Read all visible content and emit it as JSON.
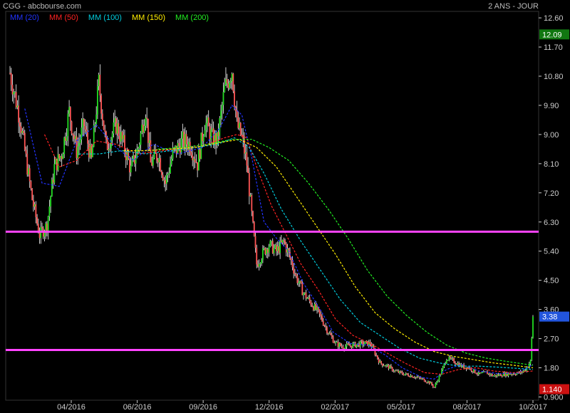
{
  "header": {
    "title": "CGG - abcbourse.com",
    "period": "2 ANS - JOUR"
  },
  "colors": {
    "up": "#22dd22",
    "down": "#ff5555",
    "wick": "#ffffff",
    "hline": "#ff44ff",
    "axis": "#cccccc",
    "last_label_bg": "#117711",
    "current_label_bg": "#2255dd",
    "low_label_bg": "#cc1111"
  },
  "chart_data": {
    "type": "candlestick",
    "ylim": [
      0.8,
      12.8
    ],
    "y_ticks": [
      "12.60",
      "11.70",
      "10.80",
      "9.90",
      "9.00",
      "8.10",
      "7.20",
      "6.30",
      "5.40",
      "4.50",
      "3.60",
      "2.70",
      "1.80",
      "0.900"
    ],
    "x_ticks": [
      "04/2016",
      "06/2016",
      "09/2016",
      "12/2016",
      "02/2017",
      "05/2017",
      "08/2017",
      "10/2017"
    ],
    "horizontal_lines": [
      6.0,
      2.35
    ],
    "price_labels": [
      {
        "value": 12.09,
        "text": "12.09",
        "kind": "last"
      },
      {
        "value": 3.38,
        "text": "3.38",
        "kind": "current"
      },
      {
        "value": 1.14,
        "text": "1.140",
        "kind": "low"
      }
    ],
    "close_path": [
      [
        0,
        10.9
      ],
      [
        8,
        9.5
      ],
      [
        18,
        7.0
      ],
      [
        24,
        5.9
      ],
      [
        30,
        6.2
      ],
      [
        36,
        8.0
      ],
      [
        42,
        8.4
      ],
      [
        48,
        9.7
      ],
      [
        54,
        8.5
      ],
      [
        60,
        9.3
      ],
      [
        66,
        8.2
      ],
      [
        72,
        10.6
      ],
      [
        78,
        8.6
      ],
      [
        86,
        9.3
      ],
      [
        92,
        8.7
      ],
      [
        98,
        7.9
      ],
      [
        104,
        8.6
      ],
      [
        110,
        9.8
      ],
      [
        114,
        8.1
      ],
      [
        120,
        8.4
      ],
      [
        126,
        7.5
      ],
      [
        132,
        8.4
      ],
      [
        140,
        8.8
      ],
      [
        146,
        8.7
      ],
      [
        152,
        8.1
      ],
      [
        158,
        9.4
      ],
      [
        164,
        8.9
      ],
      [
        168,
        8.8
      ],
      [
        174,
        10.4
      ],
      [
        180,
        11.0
      ],
      [
        184,
        9.3
      ],
      [
        188,
        8.9
      ],
      [
        192,
        8.1
      ],
      [
        196,
        6.5
      ],
      [
        200,
        5.0
      ],
      [
        206,
        5.4
      ],
      [
        210,
        5.6
      ],
      [
        216,
        5.4
      ],
      [
        222,
        5.7
      ],
      [
        228,
        5.1
      ],
      [
        232,
        4.6
      ],
      [
        238,
        4.1
      ],
      [
        244,
        3.8
      ],
      [
        250,
        3.5
      ],
      [
        254,
        3.2
      ],
      [
        258,
        2.9
      ],
      [
        264,
        2.55
      ],
      [
        270,
        2.45
      ],
      [
        278,
        2.5
      ],
      [
        286,
        2.55
      ],
      [
        292,
        2.55
      ],
      [
        300,
        1.95
      ],
      [
        306,
        1.85
      ],
      [
        312,
        1.7
      ],
      [
        320,
        1.6
      ],
      [
        326,
        1.55
      ],
      [
        334,
        1.45
      ],
      [
        340,
        1.35
      ],
      [
        344,
        1.2
      ],
      [
        350,
        1.7
      ],
      [
        354,
        2.1
      ],
      [
        360,
        2.0
      ],
      [
        366,
        1.85
      ],
      [
        372,
        1.8
      ],
      [
        380,
        1.6
      ],
      [
        386,
        1.65
      ],
      [
        392,
        1.55
      ],
      [
        400,
        1.6
      ],
      [
        408,
        1.62
      ],
      [
        414,
        1.65
      ],
      [
        418,
        1.75
      ],
      [
        422,
        2.0
      ],
      [
        424,
        3.38
      ]
    ],
    "moving_averages": [
      {
        "name": "MM (20)",
        "color": "#2233ff",
        "points": [
          [
            12,
            9.8
          ],
          [
            26,
            7.5
          ],
          [
            40,
            7.4
          ],
          [
            54,
            8.8
          ],
          [
            70,
            9.3
          ],
          [
            86,
            8.6
          ],
          [
            100,
            8.2
          ],
          [
            116,
            8.7
          ],
          [
            136,
            8.4
          ],
          [
            156,
            8.6
          ],
          [
            170,
            9.2
          ],
          [
            180,
            9.9
          ],
          [
            188,
            9.6
          ],
          [
            196,
            8.3
          ],
          [
            206,
            6.3
          ],
          [
            216,
            5.8
          ],
          [
            226,
            5.4
          ],
          [
            238,
            4.4
          ],
          [
            250,
            3.7
          ],
          [
            262,
            2.9
          ],
          [
            276,
            2.55
          ],
          [
            290,
            2.5
          ],
          [
            304,
            2.2
          ],
          [
            318,
            1.8
          ],
          [
            334,
            1.5
          ],
          [
            344,
            1.45
          ],
          [
            354,
            1.75
          ],
          [
            366,
            1.9
          ],
          [
            380,
            1.7
          ],
          [
            396,
            1.62
          ],
          [
            412,
            1.64
          ],
          [
            424,
            1.9
          ]
        ]
      },
      {
        "name": "MM (50)",
        "color": "#ff2222",
        "points": [
          [
            28,
            9.0
          ],
          [
            40,
            8.0
          ],
          [
            54,
            8.2
          ],
          [
            70,
            8.8
          ],
          [
            86,
            8.7
          ],
          [
            104,
            8.4
          ],
          [
            124,
            8.5
          ],
          [
            144,
            8.6
          ],
          [
            160,
            8.7
          ],
          [
            174,
            8.9
          ],
          [
            184,
            9.0
          ],
          [
            192,
            8.9
          ],
          [
            200,
            8.0
          ],
          [
            212,
            6.8
          ],
          [
            224,
            5.9
          ],
          [
            236,
            5.0
          ],
          [
            250,
            4.2
          ],
          [
            264,
            3.3
          ],
          [
            278,
            2.8
          ],
          [
            292,
            2.55
          ],
          [
            306,
            2.25
          ],
          [
            320,
            1.95
          ],
          [
            336,
            1.65
          ],
          [
            350,
            1.6
          ],
          [
            364,
            1.75
          ],
          [
            378,
            1.8
          ],
          [
            392,
            1.7
          ],
          [
            408,
            1.65
          ],
          [
            424,
            1.7
          ]
        ]
      },
      {
        "name": "MM (100)",
        "color": "#00ccdd",
        "points": [
          [
            56,
            8.4
          ],
          [
            72,
            8.4
          ],
          [
            90,
            8.5
          ],
          [
            110,
            8.4
          ],
          [
            130,
            8.5
          ],
          [
            150,
            8.6
          ],
          [
            168,
            8.7
          ],
          [
            182,
            8.9
          ],
          [
            194,
            8.6
          ],
          [
            206,
            7.8
          ],
          [
            220,
            6.7
          ],
          [
            236,
            5.7
          ],
          [
            252,
            4.8
          ],
          [
            268,
            3.9
          ],
          [
            284,
            3.2
          ],
          [
            300,
            2.8
          ],
          [
            316,
            2.4
          ],
          [
            332,
            2.1
          ],
          [
            348,
            1.95
          ],
          [
            364,
            1.85
          ],
          [
            380,
            1.85
          ],
          [
            396,
            1.82
          ],
          [
            412,
            1.78
          ],
          [
            424,
            1.75
          ]
        ]
      },
      {
        "name": "MM (150)",
        "color": "#ffee00",
        "points": [
          [
            92,
            8.5
          ],
          [
            110,
            8.5
          ],
          [
            130,
            8.55
          ],
          [
            150,
            8.6
          ],
          [
            170,
            8.75
          ],
          [
            186,
            8.85
          ],
          [
            200,
            8.6
          ],
          [
            216,
            8.0
          ],
          [
            232,
            7.1
          ],
          [
            248,
            6.2
          ],
          [
            264,
            5.3
          ],
          [
            280,
            4.3
          ],
          [
            296,
            3.5
          ],
          [
            312,
            3.0
          ],
          [
            328,
            2.6
          ],
          [
            344,
            2.3
          ],
          [
            360,
            2.15
          ],
          [
            376,
            2.05
          ],
          [
            392,
            1.95
          ],
          [
            408,
            1.88
          ],
          [
            424,
            1.8
          ]
        ]
      },
      {
        "name": "MM (200)",
        "color": "#22ee22",
        "points": [
          [
            120,
            8.55
          ],
          [
            140,
            8.6
          ],
          [
            160,
            8.7
          ],
          [
            180,
            8.85
          ],
          [
            196,
            8.85
          ],
          [
            210,
            8.6
          ],
          [
            226,
            8.2
          ],
          [
            242,
            7.5
          ],
          [
            258,
            6.7
          ],
          [
            274,
            5.8
          ],
          [
            290,
            4.8
          ],
          [
            306,
            4.0
          ],
          [
            322,
            3.4
          ],
          [
            338,
            2.9
          ],
          [
            354,
            2.5
          ],
          [
            370,
            2.25
          ],
          [
            386,
            2.1
          ],
          [
            402,
            2.0
          ],
          [
            416,
            1.92
          ],
          [
            424,
            1.88
          ]
        ]
      }
    ]
  }
}
